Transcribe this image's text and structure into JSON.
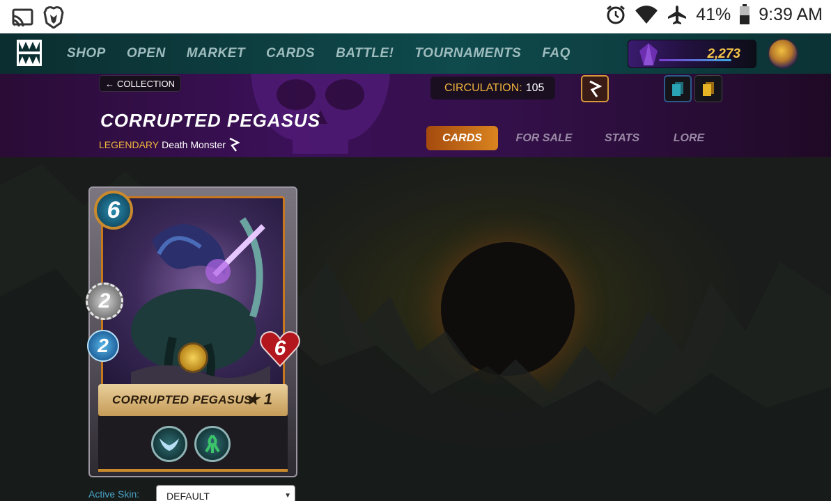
{
  "status_bar": {
    "battery_pct": "41%",
    "time": "9:39 AM",
    "icons": [
      "cast-icon",
      "brave-icon",
      "alarm-icon",
      "wifi-icon",
      "airplane-icon",
      "battery-icon"
    ]
  },
  "nav": {
    "links": [
      "SHOP",
      "OPEN",
      "MARKET",
      "CARDS",
      "BATTLE!",
      "TOURNAMENTS",
      "FAQ"
    ],
    "dec_balance": "2,273"
  },
  "header": {
    "back_label": "COLLECTION",
    "title": "CORRUPTED PEGASUS",
    "rarity": "LEGENDARY",
    "type": "Death Monster",
    "circulation_label": "CIRCULATION:",
    "circulation_value": "105",
    "tabs": [
      "CARDS",
      "FOR SALE",
      "STATS",
      "LORE"
    ],
    "active_tab": "CARDS"
  },
  "card": {
    "mana": "6",
    "attack": "2",
    "speed": "2",
    "health": "6",
    "name": "CORRUPTED PEGASUS",
    "level": "★ 1",
    "abilities": [
      "flying-icon",
      "affliction-icon"
    ]
  },
  "skin": {
    "label": "Active Skin:",
    "value": "DEFAULT"
  },
  "colors": {
    "accent_orange": "#d9841f",
    "rarity_gold": "#f0b53c",
    "nav_teal": "#0f4a4c",
    "header_purple": "#3b1058"
  }
}
